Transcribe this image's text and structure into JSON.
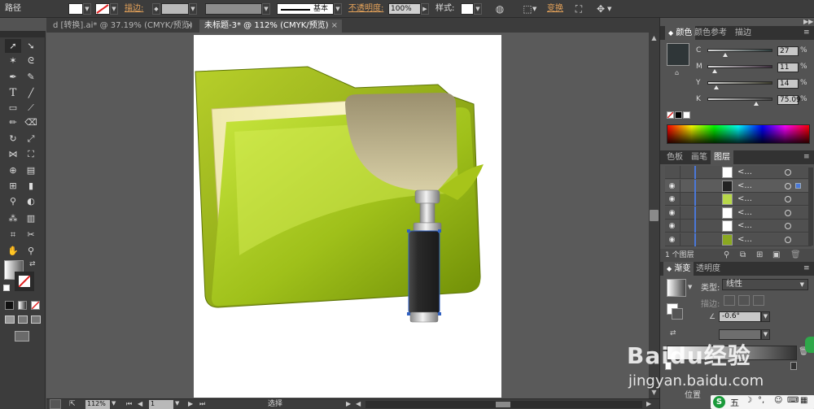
{
  "control_bar": {
    "path_label": "路径",
    "stroke_label": "描边:",
    "stroke_style_label": "基本",
    "opacity_label": "不透明度:",
    "opacity_value": "100%",
    "style_label": "样式:",
    "transform_label": "变换"
  },
  "tabs": [
    {
      "label": "d [转换].ai* @ 37.19% (CMYK/预览)",
      "close": "×",
      "active": false
    },
    {
      "label": "未标题-3* @ 112% (CMYK/预览)",
      "close": "×",
      "active": true
    }
  ],
  "status_bar": {
    "zoom": "112%",
    "page": "1",
    "tool_status": "选择"
  },
  "color_panel": {
    "tabs": [
      "颜色",
      "颜色参考",
      "描边"
    ],
    "channels": [
      {
        "name": "C",
        "value": "27",
        "fraction": 0.27,
        "track_color": "#2a3a3a"
      },
      {
        "name": "M",
        "value": "11",
        "fraction": 0.11,
        "track_color": "#3a2a3a"
      },
      {
        "name": "Y",
        "value": "14",
        "fraction": 0.14,
        "track_color": "#3a3a2a"
      },
      {
        "name": "K",
        "value": "75.09",
        "fraction": 0.75,
        "track_color": "#444444"
      }
    ],
    "swatch_color": "#2f3638"
  },
  "layers_panel": {
    "tabs": [
      "色板",
      "画笔",
      "图层"
    ],
    "rows": [
      {
        "name": "<...",
        "visible": false,
        "thumb": "#ffffff"
      },
      {
        "name": "<...",
        "visible": true,
        "thumb": "#222222"
      },
      {
        "name": "<...",
        "visible": true,
        "thumb": "#b8d84a"
      },
      {
        "name": "<...",
        "visible": true,
        "thumb": "#ffffff"
      },
      {
        "name": "<...",
        "visible": true,
        "thumb": "#ffffff"
      },
      {
        "name": "<...",
        "visible": true,
        "thumb": "#8aa820"
      }
    ],
    "footer_label": "1 个图层"
  },
  "gradient_panel": {
    "tabs": [
      "渐变",
      "透明度"
    ],
    "type_label": "类型:",
    "type_value": "线性",
    "stroke_label": "描边:",
    "angle_value": "-0.6°",
    "position_label": "位置"
  },
  "watermark": {
    "brand": "Baidu经验",
    "url": "jingyan.baidu.com"
  },
  "taskbar": {
    "ime_label": "五"
  }
}
